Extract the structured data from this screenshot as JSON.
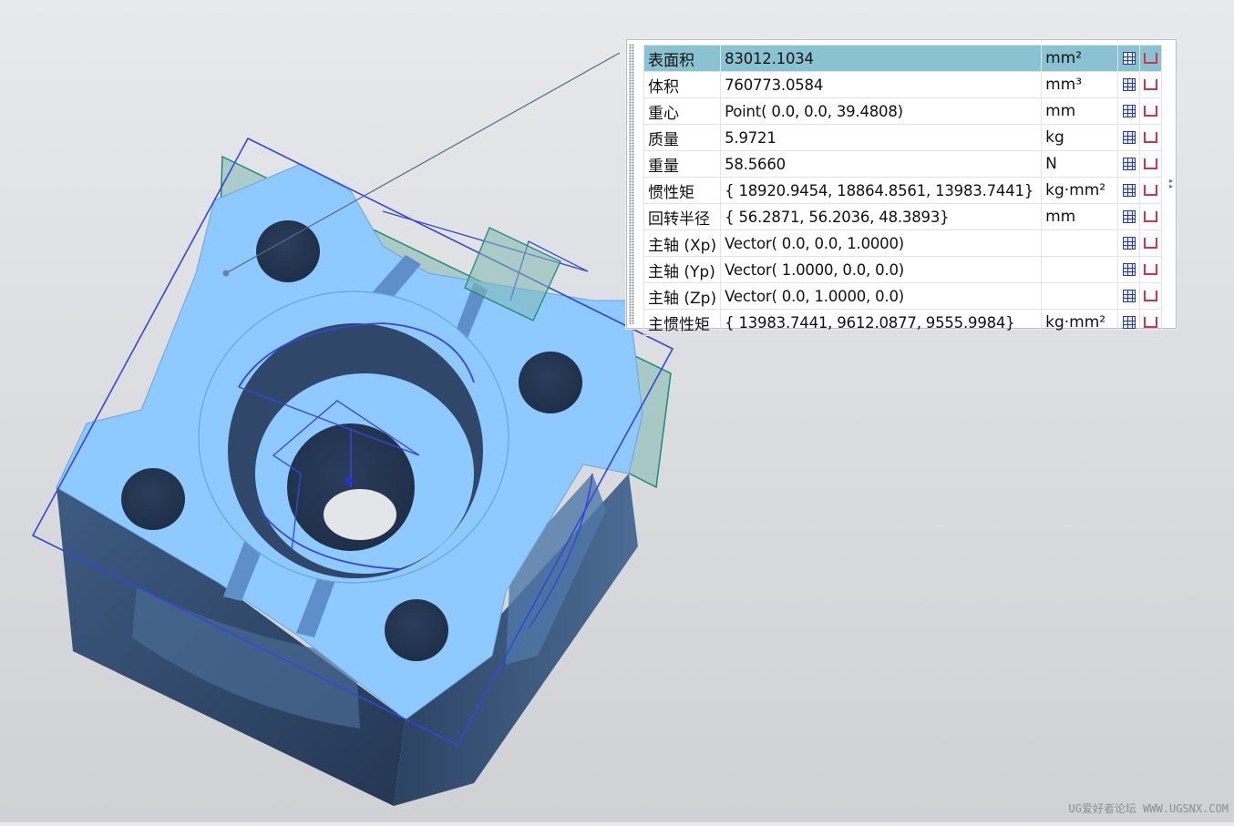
{
  "properties": {
    "rows": [
      {
        "label": "表面积",
        "value": "83012.1034",
        "unit": "mm²"
      },
      {
        "label": "体积",
        "value": "760773.0584",
        "unit": "mm³"
      },
      {
        "label": "重心",
        "value": "Point( 0.0, 0.0, 39.4808)",
        "unit": "mm"
      },
      {
        "label": "质量",
        "value": "5.9721",
        "unit": "kg"
      },
      {
        "label": "重量",
        "value": "58.5660",
        "unit": "N"
      },
      {
        "label": "惯性矩",
        "value": "{ 18920.9454, 18864.8561, 13983.7441}",
        "unit": "kg·mm²"
      },
      {
        "label": "回转半径",
        "value": "{ 56.2871, 56.2036, 48.3893}",
        "unit": "mm"
      },
      {
        "label": "主轴 (Xp)",
        "value": "Vector( 0.0, 0.0, 1.0000)",
        "unit": ""
      },
      {
        "label": "主轴 (Yp)",
        "value": "Vector( 1.0000, 0.0, 0.0)",
        "unit": ""
      },
      {
        "label": "主轴 (Zp)",
        "value": "Vector( 0.0, 1.0000, 0.0)",
        "unit": ""
      },
      {
        "label": "主惯性矩",
        "value": "{ 13983.7441, 9612.0877, 9555.9984}",
        "unit": "kg·mm²"
      }
    ],
    "selected_row_color": "#89c3d2",
    "icons": [
      "table-icon",
      "measure-icon"
    ]
  },
  "watermark": "UG爱好者论坛 WWW.UGSNX.COM",
  "colors": {
    "part_face": "#8ec9ff",
    "part_side": "#344d70",
    "bounding_box": "#3546d8",
    "plane": "#1f8a7a"
  }
}
